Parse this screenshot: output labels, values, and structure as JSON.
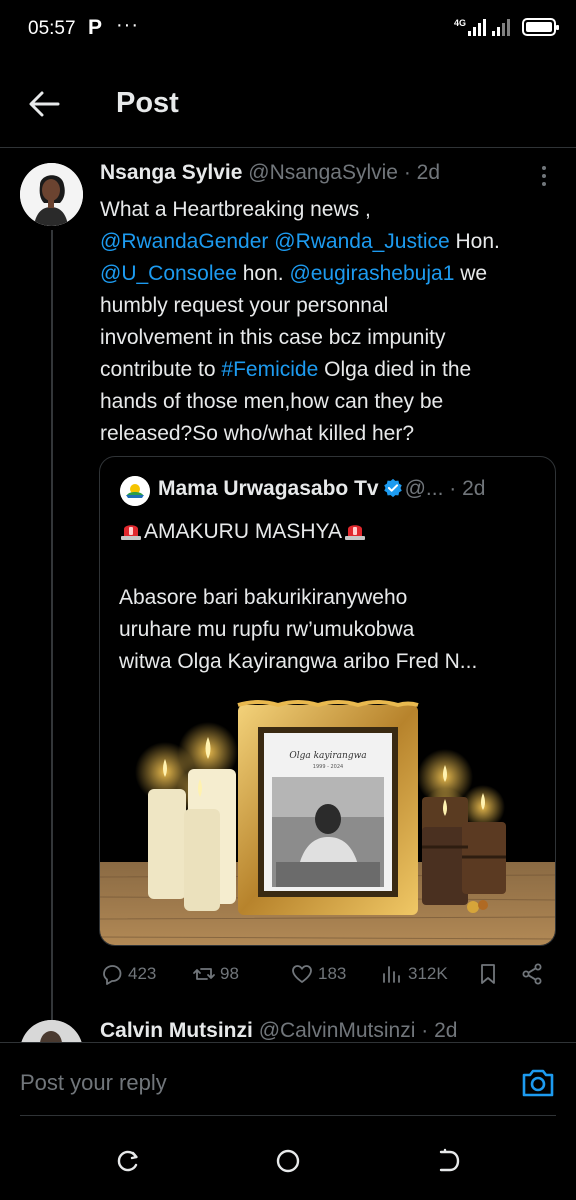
{
  "status_bar": {
    "time": "05:57",
    "app_letter": "P",
    "dots": "···",
    "network": "4G"
  },
  "header": {
    "title": "Post"
  },
  "tweet": {
    "name": "Nsanga Sylvie",
    "handle": "@NsangaSylvie",
    "time": "· 2d",
    "lines": [
      [
        {
          "t": "What a Heartbreaking news ,"
        }
      ],
      [
        {
          "t": "@RwandaGender",
          "m": true
        },
        {
          "t": " "
        },
        {
          "t": "@Rwanda_Justice",
          "m": true
        },
        {
          "t": " Hon."
        }
      ],
      [
        {
          "t": "@U_Consolee",
          "m": true
        },
        {
          "t": " hon. "
        },
        {
          "t": "@eugirashebuja1",
          "m": true
        },
        {
          "t": " we"
        }
      ],
      [
        {
          "t": "humbly request your personnal"
        }
      ],
      [
        {
          "t": "involvement in this case bcz impunity"
        }
      ],
      [
        {
          "t": "contribute to "
        },
        {
          "t": "#Femicide",
          "m": true
        },
        {
          "t": "  Olga died in the"
        }
      ],
      [
        {
          "t": "hands of those men,how can they be"
        }
      ],
      [
        {
          "t": "released?So who/what killed her?"
        }
      ]
    ]
  },
  "quote": {
    "name": "Mama Urwagasabo Tv",
    "handle": "@...",
    "time": "· 2d",
    "title": "AMAKURU MASHYA",
    "lines": [
      "Abasore bari bakurikiranyweho",
      "uruhare mu rupfu rw’umukobwa",
      "witwa Olga Kayirangwa aribo Fred N..."
    ],
    "image": {
      "frame_name": "Olga kayirangwa",
      "frame_dates": "1999 - 2024"
    }
  },
  "actions": {
    "replies": "423",
    "reposts": "98",
    "likes": "183",
    "views": "312K"
  },
  "next_tweet": {
    "name": "Calvin Mutsinzi",
    "handle": "@CalvinMutsinzi",
    "time": "· 2d"
  },
  "reply": {
    "placeholder": "Post your reply"
  },
  "colors": {
    "background": "#000000",
    "text": "#e7e9ea",
    "secondary": "#71767b",
    "link": "#1d9bf0",
    "border": "#2f3336"
  }
}
